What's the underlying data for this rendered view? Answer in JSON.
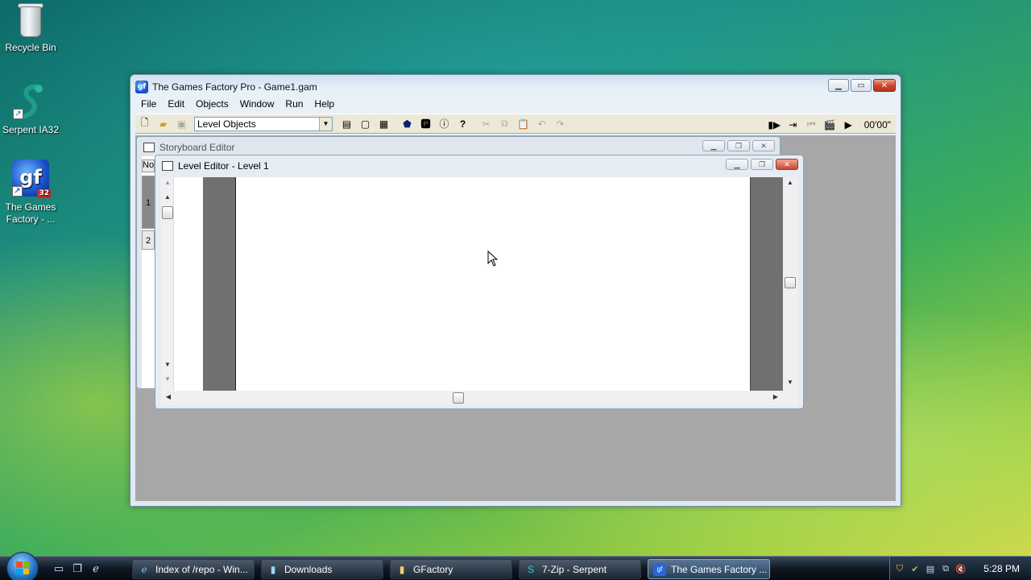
{
  "desktop": {
    "icons": [
      {
        "label": "Recycle Bin"
      },
      {
        "label": "Serpent IA32"
      },
      {
        "label": "The Games Factory - ...",
        "badge": "32",
        "glyph": "gf"
      }
    ]
  },
  "main_window": {
    "title": "The Games Factory Pro - Game1.gam",
    "icon_glyph": "gf",
    "menu": [
      "File",
      "Edit",
      "Objects",
      "Window",
      "Run",
      "Help"
    ],
    "toolbar": {
      "object_select": "Level Objects",
      "timer": "00'00\""
    }
  },
  "storyboard": {
    "title": "Storyboard Editor",
    "header": "No",
    "rows": [
      "1",
      "2"
    ]
  },
  "level_editor": {
    "title": "Level Editor - Level 1"
  },
  "taskbar": {
    "buttons": [
      {
        "label": "Index of /repo - Win..."
      },
      {
        "label": "Downloads"
      },
      {
        "label": "GFactory"
      },
      {
        "label": "7-Zip - Serpent"
      },
      {
        "label": "The Games Factory ..."
      }
    ],
    "clock": "5:28 PM"
  },
  "colors": {
    "mdi_background": "#a7a7a7",
    "close_button": "#c8442a",
    "canvas": "#ffffff"
  }
}
